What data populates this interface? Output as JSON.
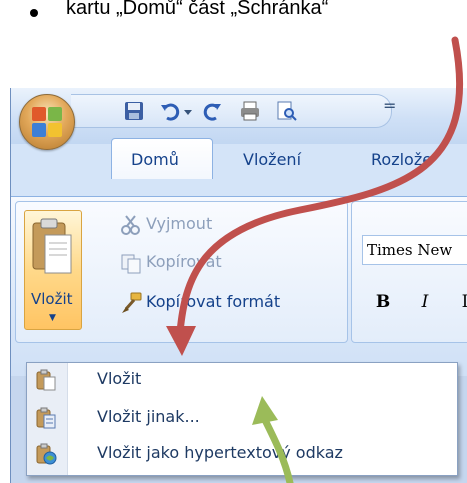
{
  "bullet": {
    "text": "kartu „Domů“ část „Schránka“"
  },
  "tabs": [
    {
      "label": "Domů",
      "active": true
    },
    {
      "label": "Vložení",
      "active": false
    },
    {
      "label": "Rozlože",
      "active": false
    }
  ],
  "qat": {
    "separator": "="
  },
  "clipboard": {
    "paste_label": "Vložit",
    "cut_label": "Vyjmout",
    "copy_label": "Kopírovat",
    "format_painter_label": "Kopírovat formát"
  },
  "font": {
    "name": "Times New",
    "bold": "B",
    "italic": "I",
    "underline": "I"
  },
  "paste_menu": {
    "items": [
      {
        "label": "Vložit"
      },
      {
        "label": "Vložit jinak..."
      },
      {
        "label": "Vložit jako hypertextový odkaz"
      }
    ]
  },
  "colors": {
    "red_arrow": "#c0504d",
    "green_arrow": "#9bbb59",
    "ribbon_text": "#15428b"
  }
}
